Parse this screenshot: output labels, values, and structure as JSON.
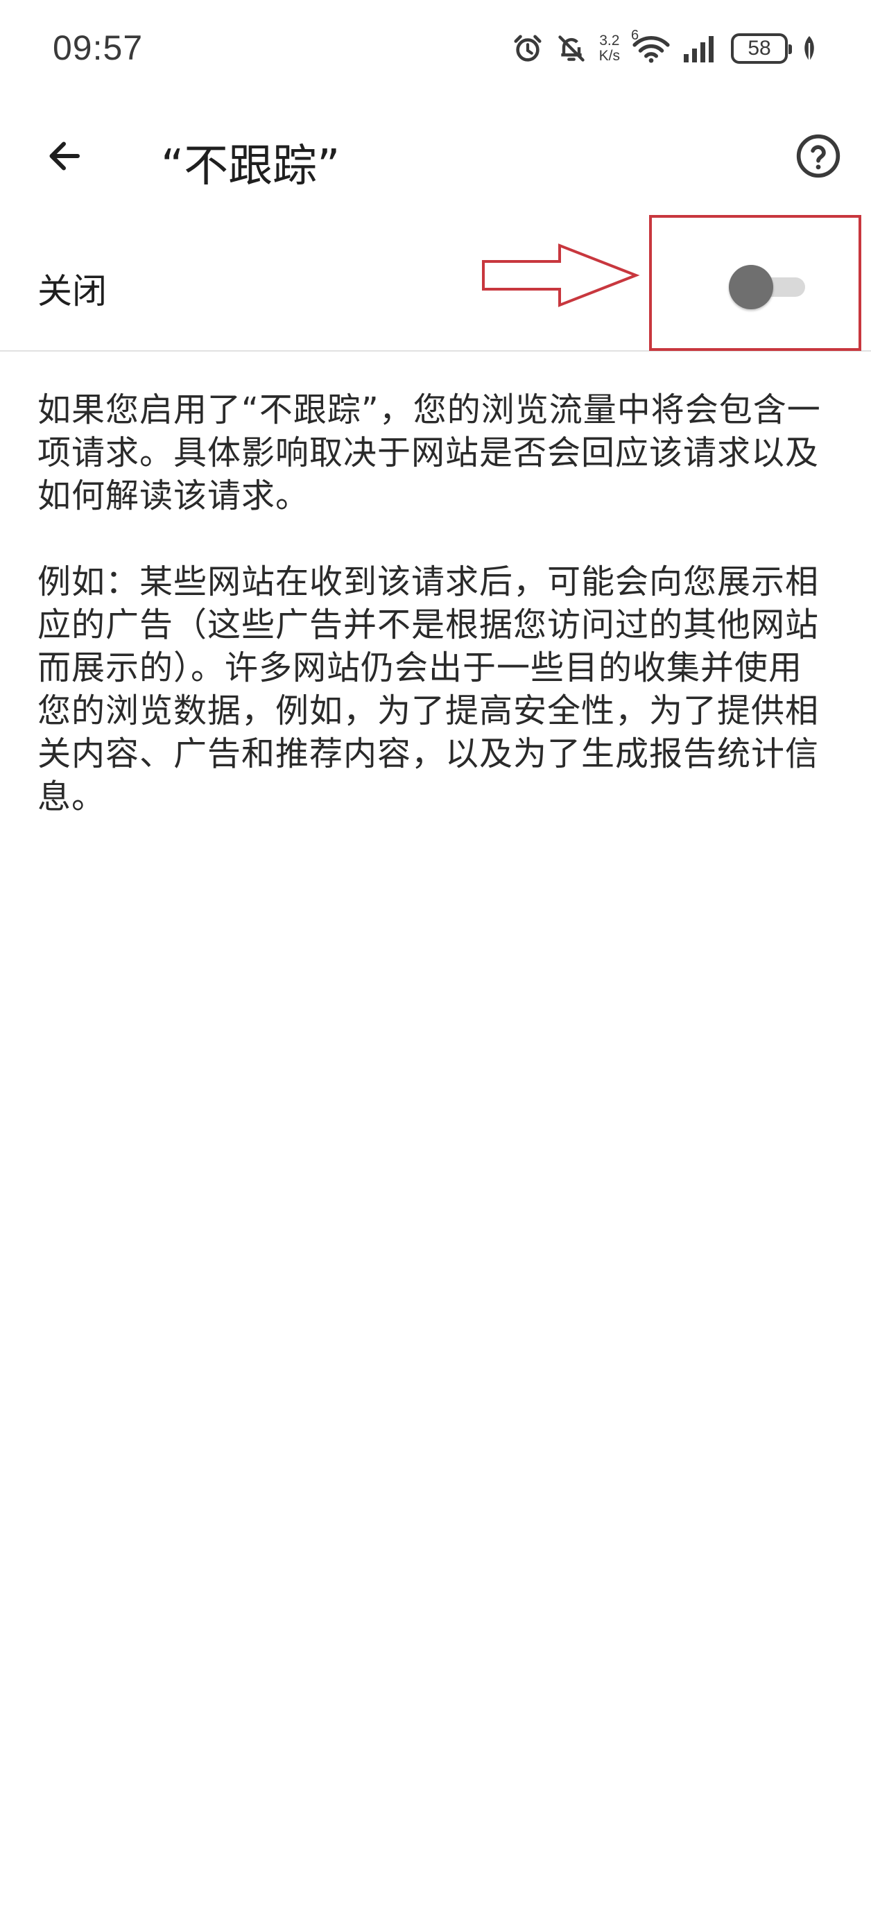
{
  "status_bar": {
    "time": "09:57",
    "net_speed_value": "3.2",
    "net_speed_unit": "K/s",
    "wifi_badge": "6",
    "battery_level": "58",
    "icons": [
      "alarm-icon",
      "bell-off-icon",
      "wifi-icon",
      "signal-icon",
      "battery-icon",
      "leaf-icon"
    ]
  },
  "app_bar": {
    "title": "“不跟踪”",
    "back_icon": "arrow-back-icon",
    "help_icon": "help-circle-icon"
  },
  "setting": {
    "label": "关闭",
    "enabled": false
  },
  "description": {
    "paragraph1": "如果您启用了“不跟踪”，您的浏览流量中将会包含一项请求。具体影响取决于网站是否会回应该请求以及如何解读该请求。",
    "paragraph2": "例如：某些网站在收到该请求后，可能会向您展示相应的广告（这些广告并不是根据您访问过的其他网站而展示的）。许多网站仍会出于一些目的收集并使用您的浏览数据，例如，为了提高安全性，为了提供相关内容、广告和推荐内容，以及为了生成报告统计信息。"
  },
  "colors": {
    "annotation_red": "#c8373e",
    "switch_thumb_off": "#6f6f6f",
    "switch_track_off": "#d9d9d9",
    "divider": "#e1e1e1"
  }
}
